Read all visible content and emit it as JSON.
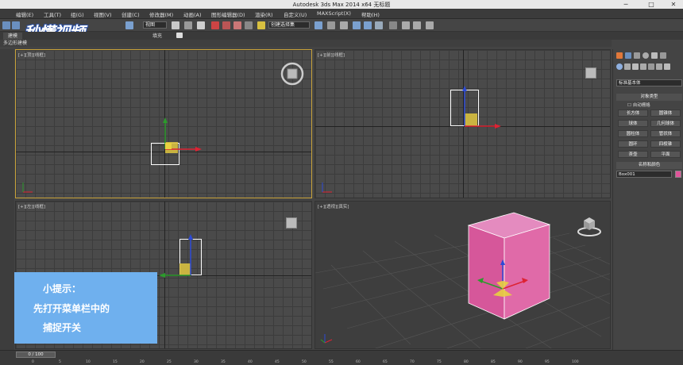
{
  "window": {
    "title": "Autodesk 3ds Max  2014 x64      无标题",
    "minimize": "─",
    "maximize": "□",
    "close": "✕"
  },
  "menu": [
    "编辑(E)",
    "工具(T)",
    "组(G)",
    "视图(V)",
    "创建(C)",
    "修改器(M)",
    "动画(A)",
    "图形编辑器(D)",
    "渲染(R)",
    "自定义(U)",
    "MAXScript(X)",
    "帮助(H)"
  ],
  "toolbar": {
    "view_select": "视图",
    "snap_select": "创建选择集"
  },
  "logo_text": "秒懂视频",
  "ribbon": {
    "tabs": [
      "建模",
      "填充"
    ],
    "sub_label": "多边形建模"
  },
  "viewports": {
    "top_label": "[+][顶][线框]",
    "front_label": "[+][前][线框]",
    "left_label": "[+][左][线框]",
    "persp_label": "[+][透视][真实]"
  },
  "command_panel": {
    "category_select": "标准基本体",
    "rollout_object_type": "对象类型",
    "autogrid": "自动栅格",
    "buttons": [
      "长方体",
      "圆锥体",
      "球体",
      "几何球体",
      "圆柱体",
      "管状体",
      "圆环",
      "四棱锥",
      "茶壶",
      "平面"
    ],
    "rollout_name_color": "名称和颜色",
    "object_name": "Box001",
    "object_color": "#e0559a"
  },
  "tip": {
    "title": "小提示：",
    "line1": "先打开菜单栏中的",
    "line2": "捕捉开关"
  },
  "timeline": {
    "frame_readout": "0 / 100",
    "ticks": [
      "0",
      "5",
      "10",
      "15",
      "20",
      "25",
      "30",
      "35",
      "40",
      "45",
      "50",
      "55",
      "60",
      "65",
      "70",
      "75",
      "80",
      "85",
      "90",
      "95",
      "100"
    ]
  },
  "colors": {
    "selected_viewport_border": "#c8a23a",
    "box_color": "#e0559a",
    "tip_background": "#6fb0ee"
  }
}
